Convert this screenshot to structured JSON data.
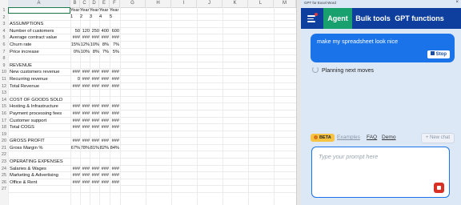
{
  "sheet": {
    "columns": [
      "A",
      "B",
      "C",
      "D",
      "E",
      "F",
      "G",
      "H",
      "I",
      "J",
      "K",
      "L",
      "M"
    ],
    "header_row_labels": [
      "Year 1",
      "Year 2",
      "Year 3",
      "Year 4",
      "Year 5"
    ],
    "rows": [
      {
        "n": "1",
        "label": "",
        "values": [
          "",
          "",
          "",
          "",
          ""
        ]
      },
      {
        "n": "2",
        "label": "",
        "values": [
          "",
          "",
          "",
          "",
          ""
        ]
      },
      {
        "n": "3",
        "label": "ASSUMPTIONS",
        "values": [
          "",
          "",
          "",
          "",
          ""
        ]
      },
      {
        "n": "4",
        "label": "Number of customers",
        "values": [
          "50",
          "120",
          "250",
          "400",
          "600"
        ]
      },
      {
        "n": "5",
        "label": "Average contract value",
        "values": [
          "###",
          "###",
          "###",
          "###",
          "###"
        ]
      },
      {
        "n": "6",
        "label": "Churn rate",
        "values": [
          "15%",
          "12%",
          "10%",
          "8%",
          "7%"
        ]
      },
      {
        "n": "7",
        "label": "Price increase",
        "values": [
          "0%",
          "10%",
          "8%",
          "7%",
          "5%"
        ]
      },
      {
        "n": "8",
        "label": "",
        "values": [
          "",
          "",
          "",
          "",
          ""
        ]
      },
      {
        "n": "9",
        "label": "REVENUE",
        "values": [
          "",
          "",
          "",
          "",
          ""
        ]
      },
      {
        "n": "10",
        "label": "New customers revenue",
        "values": [
          "###",
          "###",
          "###",
          "###",
          "###"
        ]
      },
      {
        "n": "11",
        "label": "Recurring revenue",
        "values": [
          "0",
          "###",
          "###",
          "###",
          "###"
        ]
      },
      {
        "n": "12",
        "label": "Total Revenue",
        "values": [
          "###",
          "###",
          "###",
          "###",
          "###"
        ]
      },
      {
        "n": "13",
        "label": "",
        "values": [
          "",
          "",
          "",
          "",
          ""
        ]
      },
      {
        "n": "14",
        "label": "COST OF GOODS SOLD",
        "values": [
          "",
          "",
          "",
          "",
          ""
        ]
      },
      {
        "n": "15",
        "label": "Hosting & Infrastructure",
        "values": [
          "###",
          "###",
          "###",
          "###",
          "###"
        ]
      },
      {
        "n": "16",
        "label": "Payment processing fees",
        "values": [
          "###",
          "###",
          "###",
          "###",
          "###"
        ]
      },
      {
        "n": "17",
        "label": "Customer support",
        "values": [
          "###",
          "###",
          "###",
          "###",
          "###"
        ]
      },
      {
        "n": "18",
        "label": "Total COGS",
        "values": [
          "###",
          "###",
          "###",
          "###",
          "###"
        ]
      },
      {
        "n": "19",
        "label": "",
        "values": [
          "",
          "",
          "",
          "",
          ""
        ]
      },
      {
        "n": "20",
        "label": "GROSS PROFIT",
        "values": [
          "###",
          "###",
          "###",
          "###",
          "###"
        ]
      },
      {
        "n": "21",
        "label": "Gross Margin %",
        "values": [
          "67%",
          "78%",
          "81%",
          "82%",
          "84%"
        ]
      },
      {
        "n": "22",
        "label": "",
        "values": [
          "",
          "",
          "",
          "",
          ""
        ]
      },
      {
        "n": "23",
        "label": "OPERATING EXPENSES",
        "values": [
          "",
          "",
          "",
          "",
          ""
        ]
      },
      {
        "n": "24",
        "label": "Salaries & Wages",
        "values": [
          "###",
          "###",
          "###",
          "###",
          "###"
        ]
      },
      {
        "n": "25",
        "label": "Marketing & Advertising",
        "values": [
          "###",
          "###",
          "###",
          "###",
          "###"
        ]
      },
      {
        "n": "26",
        "label": "Office & Rent",
        "values": [
          "###",
          "###",
          "###",
          "###",
          "###"
        ]
      },
      {
        "n": "27",
        "label": "",
        "values": [
          "",
          "",
          "",
          "",
          ""
        ]
      }
    ]
  },
  "panel": {
    "title": "GPT for Excel Word",
    "close": "×",
    "tabs": [
      {
        "label": "Agent",
        "active": true
      },
      {
        "label": "Bulk tools",
        "active": false
      },
      {
        "label": "GPT functions",
        "active": false
      }
    ],
    "user_message": "make my spreadsheet look nice",
    "stop_label": "Stop",
    "status": "Planning next moves",
    "beta": "BETA",
    "links": {
      "examples": "Examples",
      "faq": "FAQ",
      "demo": "Demo"
    },
    "new_chat": "+ New chat",
    "prompt_placeholder": "Type your prompt here",
    "colors": {
      "nav": "#0f3f9e",
      "active_tab": "#19a06f",
      "user_bubble": "#1a73e8",
      "send": "#d93025",
      "beta": "#f6c343"
    }
  }
}
